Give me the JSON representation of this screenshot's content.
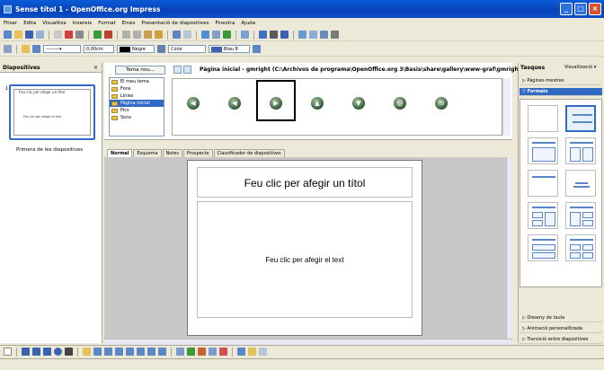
{
  "window": {
    "title": "Sense títol 1 - OpenOffice.org Impress"
  },
  "menu": [
    "Fitxer",
    "Edita",
    "Visualitza",
    "Insereix",
    "Format",
    "Eines",
    "Presentació de diapositives",
    "Finestra",
    "Ajuda"
  ],
  "line_toolbar": {
    "width_value": "0,00cm",
    "line_color": "Negre",
    "area_style": "Color",
    "area_color": "Blau 8"
  },
  "slides_panel": {
    "title": "Diapositives",
    "close": "×",
    "slide_number": "1",
    "thumb_title": "Feu clic per afegir un títol",
    "thumb_text": "Feu clic per afegir el text",
    "caption": "Primera de les diapositives"
  },
  "gallery": {
    "new_theme_button": "Tema nou...",
    "path": "Pàgina inicial - gmright (C:\\Archivos de programa\\OpenOffice.org 3\\Basis\\share\\gallery\\www-graf\\gmright.gif)",
    "themes": [
      "El meu tema",
      "Fons",
      "Línies",
      "Pàgina inicial",
      "Pics",
      "Sons"
    ],
    "selected_theme": "Pàgina inicial",
    "icons": [
      "◀",
      "◀",
      "▶",
      "▲",
      "▼",
      "@",
      "✉"
    ]
  },
  "view_tabs": [
    "Normal",
    "Esquema",
    "Notes",
    "Prospecte",
    "Classificador de diapositives"
  ],
  "slide": {
    "title_placeholder": "Feu clic per afegir un títol",
    "text_placeholder": "Feu clic per afegir el text"
  },
  "task_panel": {
    "title": "Tasques",
    "view_menu": "Visualització ▾",
    "sections_top": [
      "▷ Pàgines mestres",
      "▽ Formats"
    ],
    "sections_bottom": [
      "▷ Disseny de taula",
      "▷ Animació personalitzada",
      "▷ Transició entre diapositives"
    ]
  },
  "colors": {
    "accent": "#316ac5",
    "titlebar": "#0a4ecb",
    "chrome": "#ece9d8"
  }
}
